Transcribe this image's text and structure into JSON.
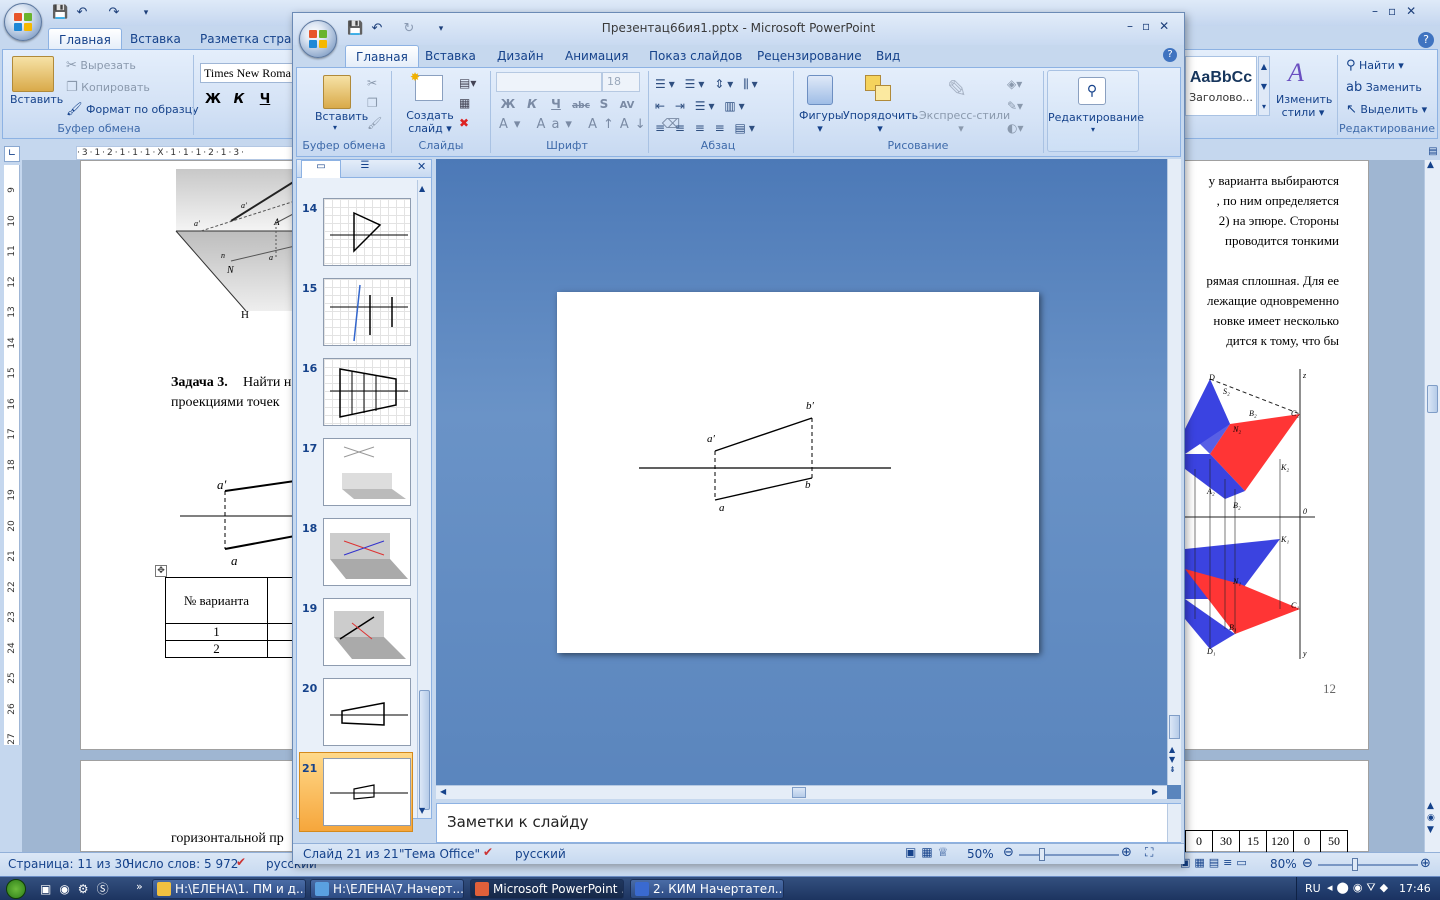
{
  "word": {
    "tabs": [
      "Главная",
      "Вставка",
      "Разметка страни"
    ],
    "font_name": "Times New Roma",
    "clipboard": {
      "paste": "Вставить",
      "cut": "Вырезать",
      "copy": "Копировать",
      "format_painter": "Формат по образцу",
      "label": "Буфер обмена"
    },
    "format_buttons": [
      "Ж",
      "К",
      "Ч"
    ],
    "styles": {
      "sample": "AaBbCc",
      "caption": "Заголово...",
      "change": "Изменить",
      "change2": "стили"
    },
    "editing": {
      "find": "Найти",
      "replace": "Заменить",
      "select": "Выделить",
      "label": "Редактирование"
    },
    "ruler_marks": "·3·1·2·1·1·1·X·1·1·1·2·1·3·",
    "vruler_numbers": [
      "9",
      "10",
      "11",
      "12",
      "13",
      "14",
      "15",
      "16",
      "17",
      "18",
      "19",
      "20",
      "21",
      "22",
      "23",
      "24",
      "25",
      "26",
      "27"
    ],
    "left_page": {
      "fig_labels": {
        "a1": "a′",
        "a2": "a′",
        "A": "A",
        "N": "N",
        "a": "a",
        "n": "n",
        "H": "Н"
      },
      "task_title": "Задача 3.",
      "task_line1": "Найти н",
      "task_line2": "проекциями точек",
      "epure": {
        "a_prime": "a′",
        "a": "a"
      },
      "table": {
        "header": "№ варианта",
        "rows": [
          "1",
          "2"
        ]
      },
      "bottom_text": "горизонтальной пр"
    },
    "right_page": {
      "lines": [
        "у варианта выбираются",
        ", по ним определяется",
        "2) на эпюре. Стороны",
        "проводится тонкими",
        "",
        "рямая сплошная. Для ее",
        "лежащие одновременно",
        "новке имеет несколько",
        "дится к тому, что бы"
      ],
      "figure_labels": [
        "D",
        "S₂",
        "z",
        "B₂",
        "C₂",
        "N₂",
        "K₂",
        "A₂",
        "B₂",
        "0",
        "K₁",
        "N₁",
        "B₁",
        "C₁",
        "D₁",
        "y"
      ],
      "page_number": "12",
      "table_cells": [
        "0",
        "30",
        "15",
        "120",
        "0",
        "50"
      ]
    },
    "status": {
      "page": "Страница: 11 из 30",
      "words": "Число слов: 5 972",
      "lang": "русский",
      "zoom": "80%"
    }
  },
  "ppt": {
    "title": "Презентац66ия1.pptx - Microsoft PowerPoint",
    "tabs": [
      "Главная",
      "Вставка",
      "Дизайн",
      "Анимация",
      "Показ слайдов",
      "Рецензирование",
      "Вид"
    ],
    "ribbon": {
      "paste": "Вставить",
      "clipboard_label": "Буфер обмена",
      "new_slide": "Создать",
      "new_slide2": "слайд",
      "slides_label": "Слайды",
      "font_size": "18",
      "font_label": "Шрифт",
      "font_buttons": [
        "Ж",
        "К",
        "Ч",
        "abc",
        "S",
        "AV"
      ],
      "para_label": "Абзац",
      "shapes": "Фигуры",
      "arrange": "Упорядочить",
      "quick_styles": "Экспресс-стили",
      "drawing_label": "Рисование",
      "editing": "Редактирование"
    },
    "thumbnails": [
      "14",
      "15",
      "16",
      "17",
      "18",
      "19",
      "20",
      "21"
    ],
    "selected_slide": "21",
    "slide": {
      "a_prime": "a′",
      "b_prime": "b′",
      "a": "a",
      "b": "b"
    },
    "notes_placeholder": "Заметки к слайду",
    "status": {
      "slide": "Слайд 21 из 21",
      "theme": "\"Тема Office\"",
      "lang": "русский",
      "zoom": "50%"
    }
  },
  "taskbar": {
    "tasks": [
      "H:\\ЕЛЕНА\\1. ПМ и д...",
      "H:\\ЕЛЕНА\\7.Начерт...",
      "Microsoft PowerPoint ...",
      "2. КИМ Начертател..."
    ],
    "lang": "RU",
    "time": "17:46"
  }
}
